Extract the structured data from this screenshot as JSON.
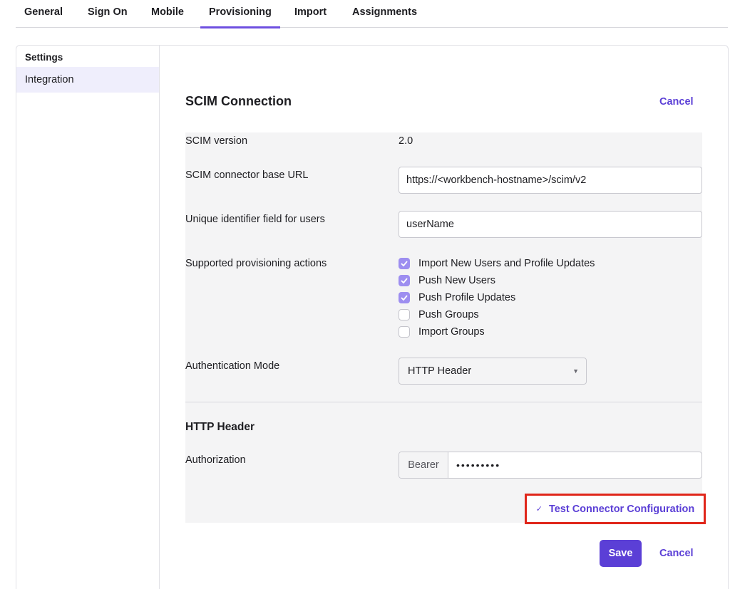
{
  "tabs": [
    {
      "label": "General"
    },
    {
      "label": "Sign On"
    },
    {
      "label": "Mobile"
    },
    {
      "label": "Provisioning",
      "active": true
    },
    {
      "label": "Import"
    },
    {
      "label": "Assignments"
    }
  ],
  "sidebar": {
    "title": "Settings",
    "items": [
      {
        "label": "Integration",
        "selected": true
      }
    ]
  },
  "scim": {
    "title": "SCIM Connection",
    "cancel_label": "Cancel",
    "version_label": "SCIM version",
    "version_value": "2.0",
    "base_url_label": "SCIM connector base URL",
    "base_url_value": "https://<workbench-hostname>/scim/v2",
    "unique_id_label": "Unique identifier field for users",
    "unique_id_value": "userName",
    "actions_label": "Supported provisioning actions",
    "actions": [
      {
        "label": "Import New Users and Profile Updates",
        "checked": true
      },
      {
        "label": "Push New Users",
        "checked": true
      },
      {
        "label": "Push Profile Updates",
        "checked": true
      },
      {
        "label": "Push Groups",
        "checked": false
      },
      {
        "label": "Import Groups",
        "checked": false
      }
    ],
    "auth_mode_label": "Authentication Mode",
    "auth_mode_value": "HTTP Header"
  },
  "http_header": {
    "title": "HTTP Header",
    "authorization_label": "Authorization",
    "prefix": "Bearer",
    "token_masked": "•••••••••",
    "test_label": "Test Connector Configuration"
  },
  "footer": {
    "save_label": "Save",
    "cancel_label": "Cancel"
  },
  "colors": {
    "accent": "#5b3fd6",
    "checkbox_checked": "#9d8ef0",
    "highlight_border": "#e0261a",
    "form_bg": "#f4f4f5"
  }
}
